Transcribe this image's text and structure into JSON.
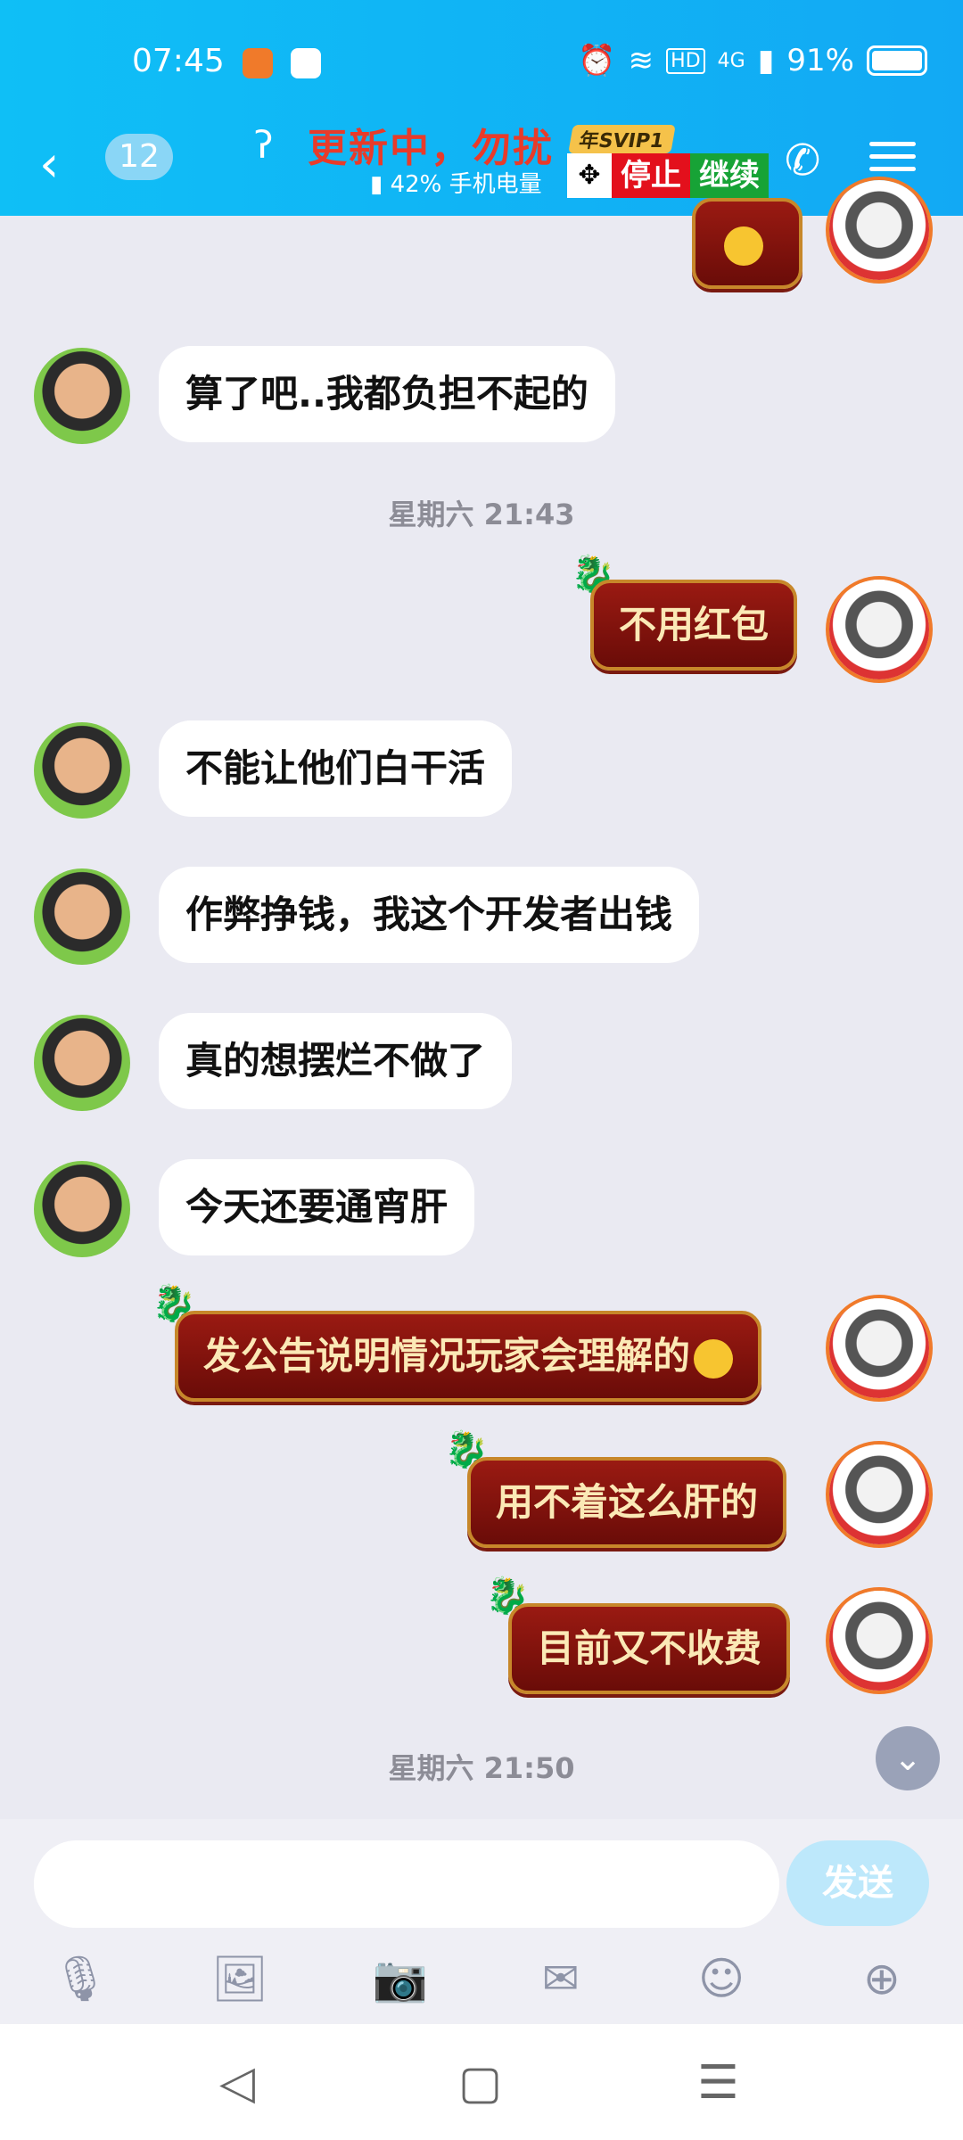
{
  "status": {
    "time": "07:45",
    "network": "4G",
    "battery": "91%"
  },
  "header": {
    "back_icon": "chevron-left",
    "unread_badge": "12",
    "title": "更新中，勿扰",
    "svip": "年SVIP1",
    "phone_battery": "42% 手机电量",
    "stop_label": "停止",
    "continue_label": "继续"
  },
  "messages": [
    {
      "side": "left",
      "text": "算了吧..我都负担不起的"
    },
    {
      "type": "time",
      "text": "星期六 21:43"
    },
    {
      "side": "right",
      "text": "不用红包"
    },
    {
      "side": "left",
      "text": "不能让他们白干活"
    },
    {
      "side": "left",
      "text": "作弊挣钱，我这个开发者出钱"
    },
    {
      "side": "left",
      "text": "真的想摆烂不做了"
    },
    {
      "side": "left",
      "text": "今天还要通宵肝"
    },
    {
      "side": "right",
      "text": "发公告说明情况玩家会理解的"
    },
    {
      "side": "right",
      "text": "用不着这么肝的"
    },
    {
      "side": "right",
      "text": "目前又不收费"
    },
    {
      "type": "time",
      "text": "星期六 21:50"
    }
  ],
  "input": {
    "placeholder": "",
    "send_label": "发送"
  },
  "colors": {
    "header": "#12a9f4",
    "bubble_right": "#8a130d",
    "send": "#bde8fb"
  }
}
